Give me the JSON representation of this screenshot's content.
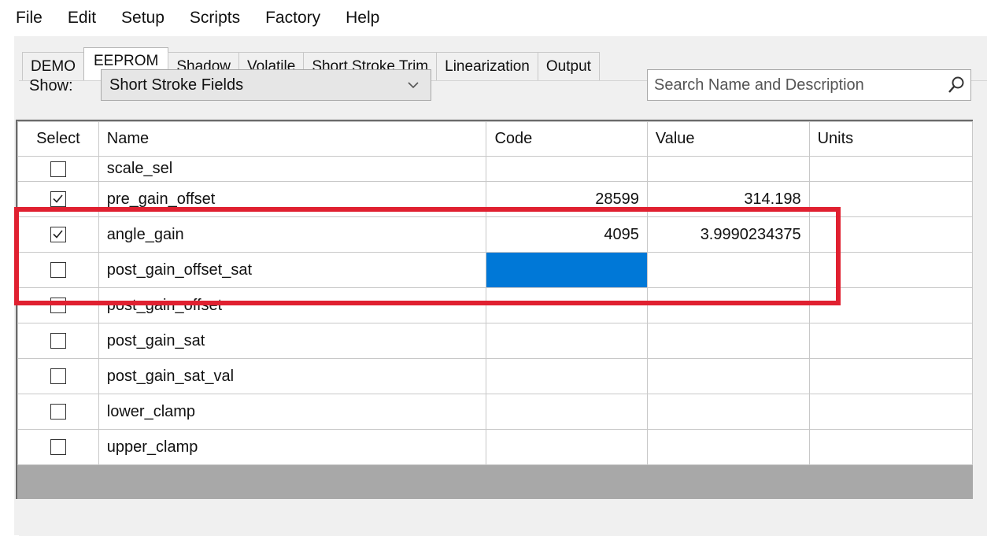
{
  "menu": [
    "File",
    "Edit",
    "Setup",
    "Scripts",
    "Factory",
    "Help"
  ],
  "tabs": [
    {
      "label": "DEMO",
      "active": false
    },
    {
      "label": "EEPROM",
      "active": true
    },
    {
      "label": "Shadow",
      "active": false
    },
    {
      "label": "Volatile",
      "active": false
    },
    {
      "label": "Short Stroke Trim",
      "active": false
    },
    {
      "label": "Linearization",
      "active": false
    },
    {
      "label": "Output",
      "active": false
    }
  ],
  "filter": {
    "show_label": "Show:",
    "show_value": "Short Stroke Fields",
    "search_placeholder": "Search Name and Description"
  },
  "table": {
    "headers": {
      "select": "Select",
      "name": "Name",
      "code": "Code",
      "value": "Value",
      "units": "Units"
    },
    "rows": [
      {
        "checked": false,
        "name": "scale_sel",
        "code": "",
        "value": "",
        "units": ""
      },
      {
        "checked": true,
        "name": "pre_gain_offset",
        "code": "28599",
        "value": "314.198",
        "units": ""
      },
      {
        "checked": true,
        "name": "angle_gain",
        "code": "4095",
        "value": "3.9990234375",
        "units": ""
      },
      {
        "checked": false,
        "name": "post_gain_offset_sat",
        "code": "",
        "value": "",
        "units": ""
      },
      {
        "checked": false,
        "name": "post_gain_offset",
        "code": "",
        "value": "",
        "units": ""
      },
      {
        "checked": false,
        "name": "post_gain_sat",
        "code": "",
        "value": "",
        "units": ""
      },
      {
        "checked": false,
        "name": "post_gain_sat_val",
        "code": "",
        "value": "",
        "units": ""
      },
      {
        "checked": false,
        "name": "lower_clamp",
        "code": "",
        "value": "",
        "units": ""
      },
      {
        "checked": false,
        "name": "upper_clamp",
        "code": "",
        "value": "",
        "units": ""
      }
    ]
  },
  "colors": {
    "selection": "#0078d7",
    "highlight": "#e02030"
  }
}
